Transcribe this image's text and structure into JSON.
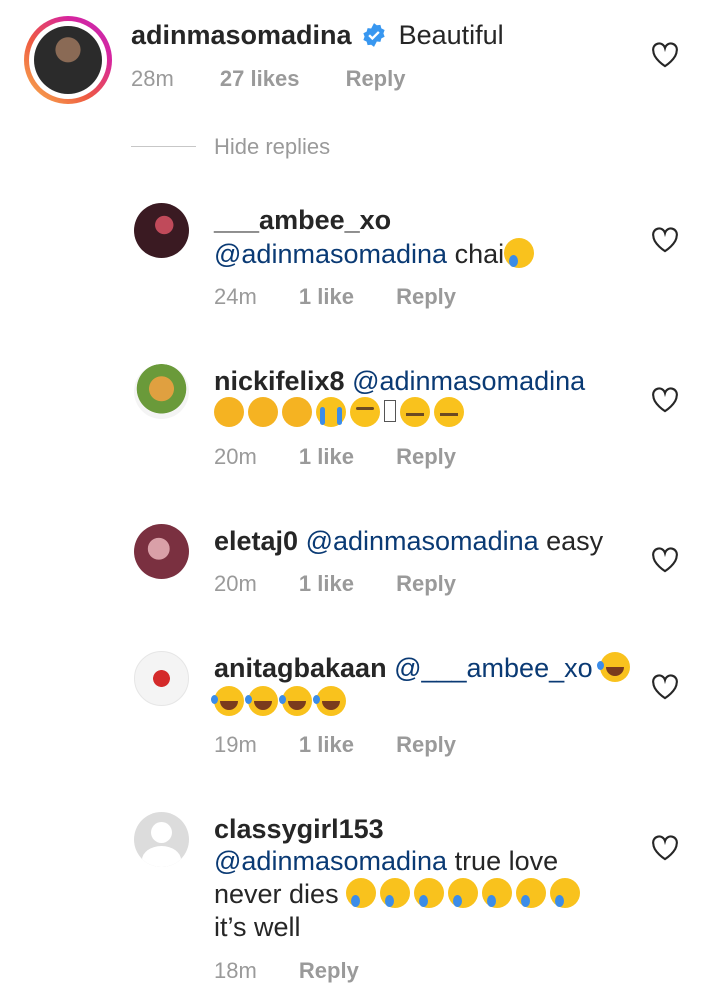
{
  "main_comment": {
    "username": "adinmasomadina",
    "verified_icon": "verified-badge-icon",
    "text": "Beautiful",
    "time": "28m",
    "likes": "27 likes",
    "reply": "Reply"
  },
  "hide_replies": "Hide replies",
  "replies": [
    {
      "username": "___ambee_xo",
      "mention": "@adinmasomadina",
      "text": "chai",
      "emoji": [
        "crying-face"
      ],
      "time": "24m",
      "likes": "1 like",
      "reply": "Reply"
    },
    {
      "username": "nickifelix8",
      "mention": "@adinmasomadina",
      "emoji": [
        "thinking-face",
        "thinking-face",
        "thinking-face",
        "face-screaming",
        "sleepy-face",
        "unknown-glyph",
        "zipper-mouth-face",
        "zipper-mouth-face"
      ],
      "time": "20m",
      "likes": "1 like",
      "reply": "Reply"
    },
    {
      "username": "eletaj0",
      "mention": "@adinmasomadina",
      "text": "easy",
      "time": "20m",
      "likes": "1 like",
      "reply": "Reply"
    },
    {
      "username": "anitagbakaan",
      "mention": "@___ambee_xo",
      "emoji": [
        "tears-of-joy",
        "tears-of-joy",
        "tears-of-joy",
        "tears-of-joy",
        "tears-of-joy"
      ],
      "time": "19m",
      "likes": "1 like",
      "reply": "Reply"
    },
    {
      "username": "classygirl153",
      "mention": "@adinmasomadina",
      "text": "true love",
      "text2": "never dies",
      "text3": "it’s well",
      "emoji": [
        "crying-face",
        "crying-face",
        "crying-face",
        "crying-face",
        "crying-face",
        "crying-face",
        "crying-face"
      ],
      "time": "18m",
      "reply": "Reply"
    }
  ],
  "colors": {
    "mention": "#0a3a74",
    "meta": "#9a9a9a",
    "story_ring": "#ee5a42"
  }
}
